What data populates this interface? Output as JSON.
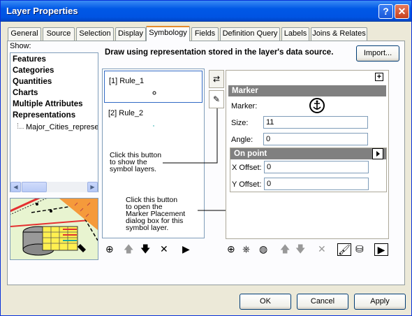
{
  "window": {
    "title": "Layer Properties",
    "help_label": "?",
    "close_label": "✕"
  },
  "tabs": [
    "General",
    "Source",
    "Selection",
    "Display",
    "Symbology",
    "Fields",
    "Definition Query",
    "Labels",
    "Joins & Relates"
  ],
  "show": {
    "label": "Show:",
    "items": [
      "Features",
      "Categories",
      "Quantities",
      "Charts",
      "Multiple Attributes",
      "Representations"
    ],
    "subitem": "Major_Cities_represen"
  },
  "description": "Draw using representation stored in the layer's data source.",
  "import_label": "Import...",
  "rules": [
    "[1] Rule_1",
    "[2] Rule_2"
  ],
  "note1": [
    "Click this button",
    "to show the",
    "symbol layers."
  ],
  "note2": [
    "Click this button",
    "to open the",
    "Marker Placement",
    "dialog box for this",
    "symbol layer."
  ],
  "marker": {
    "header": "Marker",
    "marker_label": "Marker:",
    "size_label": "Size:",
    "size_value": "11",
    "angle_label": "Angle:",
    "angle_value": "0",
    "onpoint_header": "On point",
    "xoffset_label": "X Offset:",
    "xoffset_value": "0",
    "yoffset_label": "Y Offset:",
    "yoffset_value": "0"
  },
  "buttons": {
    "ok": "OK",
    "cancel": "Cancel",
    "apply": "Apply"
  },
  "colors": {
    "titlebar": "#0054e3",
    "tab_highlight": "#e68b2c",
    "header_gray": "#808080",
    "selection": "#316ac5"
  }
}
